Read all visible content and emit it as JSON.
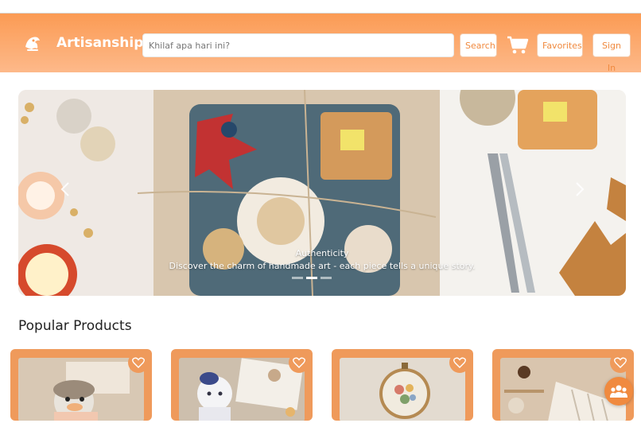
{
  "header": {
    "brand": "Artisanship",
    "search": {
      "placeholder": "Khilaf apa hari ini?",
      "value": ""
    },
    "search_button": "Search",
    "favorites_button": "Favorites",
    "signin_button": "Sign In"
  },
  "hero": {
    "title": "Authenticity",
    "text": "Discover the charm of handmade art - each piece tells a unique story.",
    "slides": 3,
    "active_slide": 1
  },
  "popular": {
    "title": "Popular Products"
  },
  "colors": {
    "accent": "#f08a3f",
    "header_gradient_top": "#fb9b54",
    "header_gradient_bottom": "#fdb98a",
    "card_bg": "#ef9a5b"
  },
  "icons": [
    "logo-icon",
    "cart-icon",
    "chevron-left-icon",
    "chevron-right-icon",
    "heart-icon",
    "group-chat-icon"
  ]
}
